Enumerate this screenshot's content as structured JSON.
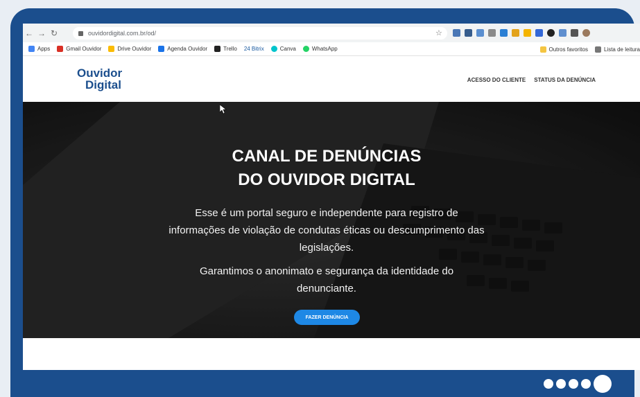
{
  "browser": {
    "url": "ouvidordigital.com.br/od/",
    "bookmarks": [
      {
        "label": "Apps",
        "color": "#4285f4"
      },
      {
        "label": "Gmail Ouvidor",
        "color": "#d93025"
      },
      {
        "label": "Drive Ouvidor",
        "color": "#fbbc04"
      },
      {
        "label": "Agenda Ouvidor",
        "color": "#1a73e8"
      },
      {
        "label": "Trello",
        "color": "#222222"
      },
      {
        "label": "24  Bitrix",
        "color": "#2fa4e7"
      },
      {
        "label": "Canva",
        "color": "#00c4cc"
      },
      {
        "label": "WhatsApp",
        "color": "#25d366"
      }
    ],
    "other_favorites": "Outros favoritos",
    "reading_list": "Lista de leitura"
  },
  "site": {
    "logo_line1": "Ouvidor",
    "logo_line2": "Digital",
    "nav": {
      "client_access": "ACESSO DO CLIENTE",
      "report_status": "STATUS DA DENÚNCIA"
    }
  },
  "hero": {
    "title_line1": "CANAL DE DENÚNCIAS",
    "title_line2": "DO OUVIDOR DIGITAL",
    "paragraph1": "Esse é um portal seguro e independente para registro de informações de violação de condutas éticas ou descumprimento das legislações.",
    "paragraph2": "Garantimos o anonimato e segurança da identidade do denunciante.",
    "cta_label": "FAZER DENÚNCIA"
  },
  "colors": {
    "frame": "#1b4e8d",
    "brand_blue": "#1b4e8d",
    "cta_blue": "#1e88e5"
  },
  "carousel": {
    "total": 5,
    "active": 5
  }
}
